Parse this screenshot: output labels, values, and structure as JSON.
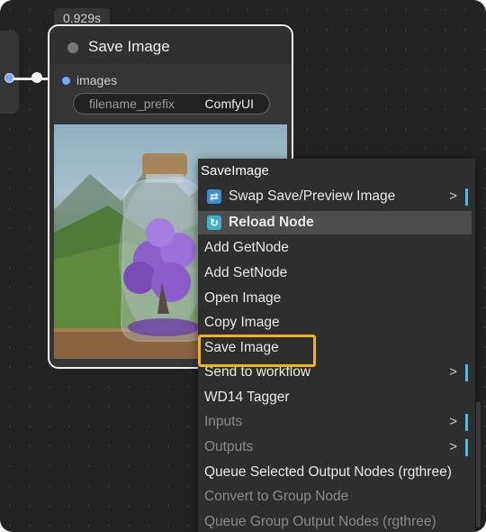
{
  "node": {
    "timer": "0.929s",
    "title": "Save Image",
    "input_label": "images",
    "widget": {
      "name": "filename_prefix",
      "value": "ComfyUI"
    }
  },
  "context_menu": {
    "title": "SaveImage",
    "items": [
      {
        "label": "Swap Save/Preview Image",
        "icon": "swap-icon",
        "submenu": true,
        "disabled": false
      },
      {
        "label": "Reload Node",
        "icon": "reload-icon",
        "highlighted": true,
        "disabled": false
      },
      {
        "label": "Add GetNode",
        "disabled": false
      },
      {
        "label": "Add SetNode",
        "disabled": false
      },
      {
        "label": "Open Image",
        "disabled": false
      },
      {
        "label": "Copy Image",
        "disabled": false
      },
      {
        "label": "Save Image",
        "disabled": false,
        "focused": true
      },
      {
        "label": "Send to workflow",
        "submenu": true,
        "disabled": false
      },
      {
        "label": "WD14 Tagger",
        "disabled": false
      },
      {
        "label": "Inputs",
        "submenu": true,
        "disabled": true
      },
      {
        "label": "Outputs",
        "submenu": true,
        "disabled": true
      },
      {
        "label": "Queue Selected Output Nodes (rgthree)",
        "disabled": false
      },
      {
        "label": "Convert to Group Node",
        "disabled": true
      },
      {
        "label": "Queue Group Output Nodes (rgthree)",
        "disabled": true
      }
    ],
    "submenu_arrow": ">"
  },
  "colors": {
    "canvas": "#222222",
    "node_body": "#353535",
    "menu_bg": "#2e2e2e",
    "focus_outline": "#f2b21d",
    "submenu_accent": "#45c1e8",
    "slot_blue": "#7aa7ff"
  }
}
